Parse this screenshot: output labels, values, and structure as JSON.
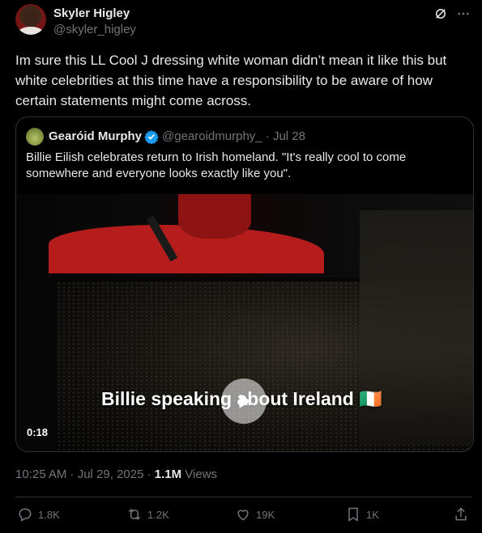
{
  "author": {
    "name": "Skyler Higley",
    "handle": "@skyler_higley"
  },
  "top_icons": [
    "grok-icon",
    "more-icon"
  ],
  "tweet": {
    "text": "Im sure this LL Cool J dressing white woman didn’t mean it like this but white celebrities at this time have a responsibility to be aware of how certain statements might come across."
  },
  "quote": {
    "name": "Gearóid Murphy",
    "handle_date": "@gearoidmurphy_ · Jul 28",
    "text": "Billie Eilish celebrates return to Irish homeland. \"It's really cool to come somewhere and everyone looks exactly like you\".",
    "video": {
      "title": "Billie speaking about Ireland 🇮🇪",
      "duration": "0:18"
    }
  },
  "meta": {
    "time": "10:25 AM · Jul 29, 2025 · ",
    "views_count": "1.1M",
    "views_label": " Views"
  },
  "actions": {
    "replies": "1.8K",
    "reposts": "1.2K",
    "likes": "19K",
    "bookmarks": "1K"
  },
  "colors": {
    "background": "#000000",
    "text": "#e7e9ea",
    "muted": "#71767b",
    "verified": "#1d9bf0",
    "border": "#2f3336"
  }
}
